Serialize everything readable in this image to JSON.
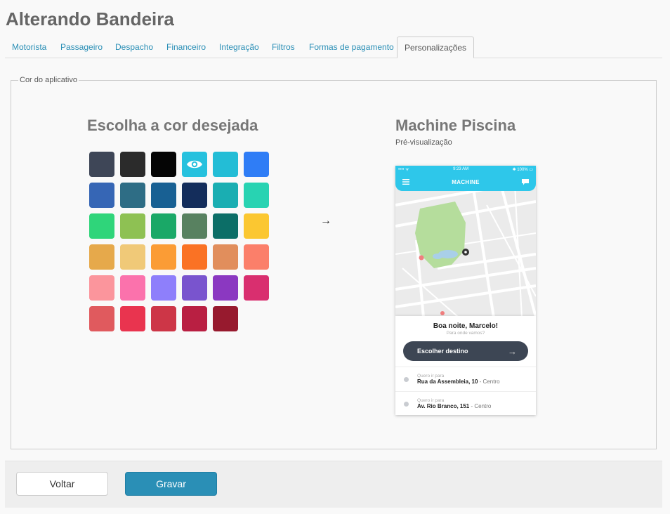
{
  "page": {
    "title": "Alterando Bandeira"
  },
  "tabs": [
    {
      "label": "Motorista",
      "active": false
    },
    {
      "label": "Passageiro",
      "active": false
    },
    {
      "label": "Despacho",
      "active": false
    },
    {
      "label": "Financeiro",
      "active": false
    },
    {
      "label": "Integração",
      "active": false
    },
    {
      "label": "Filtros",
      "active": false
    },
    {
      "label": "Formas de pagamento",
      "active": false
    },
    {
      "label": "Personalizações",
      "active": true
    }
  ],
  "panel": {
    "legend": "Cor do aplicativo",
    "choose_title": "Escolha a cor desejada",
    "selected_color": "#26c1de",
    "colors": [
      "#3e4657",
      "#2b2b2b",
      "#050505",
      "#26c1de",
      "#23bdd6",
      "#2f7df6",
      "#3666b5",
      "#2e6d85",
      "#186093",
      "#142d5b",
      "#1aaeb2",
      "#28d3b2",
      "#2fd57a",
      "#8ec153",
      "#1aa867",
      "#588160",
      "#0c6e67",
      "#fbc731",
      "#e6a94b",
      "#f0c978",
      "#fb9c35",
      "#fa7224",
      "#e18e5c",
      "#fb7f6a",
      "#fb959c",
      "#fb72ac",
      "#8e7ffb",
      "#7954ce",
      "#8b38c1",
      "#d92f6f",
      "#e05a5e",
      "#e9344f",
      "#cd3647",
      "#b91f42",
      "#971a2e"
    ],
    "arrow": "→",
    "preview_title": "Machine Piscina",
    "preview_subtitle": "Pré-visualização"
  },
  "phone": {
    "status_left": "•••• ᯤ",
    "status_time": "9:23 AM",
    "status_right": "✱ 100% ▭",
    "app_name": "MACHINE",
    "greeting": "Boa noite, Marcelo!",
    "greeting_sub": "Para onde vamos?",
    "dest_button": "Escolher destino",
    "places": [
      {
        "hint": "Quero ir para",
        "street": "Rua da Assembleia, 10",
        "area": " - Centro"
      },
      {
        "hint": "Quero ir para",
        "street": "Av. Rio Branco, 151",
        "area": " - Centro"
      }
    ]
  },
  "footer": {
    "back_label": "Voltar",
    "save_label": "Gravar"
  }
}
